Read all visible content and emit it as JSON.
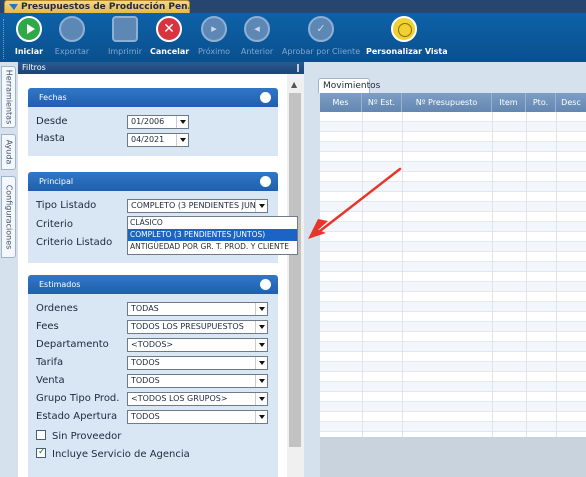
{
  "window": {
    "title": "Presupuestos de Producción Pen..."
  },
  "toolbar": {
    "buttons": [
      {
        "label": "Iniciar",
        "icon": "play-icon",
        "enabled": true
      },
      {
        "label": "Exportar",
        "icon": "export-icon",
        "enabled": false
      },
      {
        "label": "Imprimir",
        "icon": "printer-icon",
        "enabled": false
      },
      {
        "label": "Cancelar",
        "icon": "cancel-icon",
        "enabled": true
      },
      {
        "label": "Próximo",
        "icon": "next-icon",
        "enabled": false
      },
      {
        "label": "Anterior",
        "icon": "previous-icon",
        "enabled": false
      },
      {
        "label": "Aprobar por Cliente",
        "icon": "approve-icon",
        "enabled": false
      },
      {
        "label": "Personalizar Vista",
        "icon": "customize-view-icon",
        "enabled": true
      }
    ]
  },
  "side_tabs": [
    "Herramientas",
    "Ayuda",
    "Configuraciones"
  ],
  "filtros": {
    "title": "Filtros",
    "pin": "‖",
    "fechas": {
      "title": "Fechas",
      "desde_label": "Desde",
      "desde_value": "01/2006",
      "hasta_label": "Hasta",
      "hasta_value": "04/2021"
    },
    "principal": {
      "title": "Principal",
      "tipo_listado_label": "Tipo Listado",
      "tipo_listado_value": "COMPLETO (3 PENDIENTES JUNTOS)",
      "criterio_label": "Criterio",
      "criterio_listado_label": "Criterio Listado",
      "options": [
        "CLÁSICO",
        "COMPLETO (3 PENDIENTES JUNTOS)",
        "ANTIGÜEDAD POR GR. T. PROD. Y CLIENTE"
      ],
      "selected_option": 1
    },
    "estimados": {
      "title": "Estimados",
      "fields": [
        {
          "label": "Ordenes",
          "value": "TODAS"
        },
        {
          "label": "Fees",
          "value": "TODOS LOS PRESUPUESTOS"
        },
        {
          "label": "Departamento",
          "value": "<TODOS>"
        },
        {
          "label": "Tarifa",
          "value": "TODOS"
        },
        {
          "label": "Venta",
          "value": "TODOS"
        },
        {
          "label": "Grupo Tipo Prod.",
          "value": "<TODOS LOS GRUPOS>"
        },
        {
          "label": "Estado Apertura",
          "value": "TODOS"
        }
      ],
      "checkboxes": [
        {
          "label": "Sin Proveedor",
          "checked": false
        },
        {
          "label": "Incluye Servicio de Agencia",
          "checked": true
        }
      ]
    }
  },
  "movimientos": {
    "tab_label": "Movimientos",
    "columns": [
      "Mes",
      "Nº Est.",
      "Nº Presupuesto",
      "Item",
      "Pto.",
      "Desc"
    ]
  },
  "colors": {
    "toolbar": "#0a4f8e",
    "group_header": "#2a6cc0",
    "group_body": "#d9e6f3",
    "selected_option": "#1c63c6",
    "annotation_arrow": "#e8352b"
  }
}
